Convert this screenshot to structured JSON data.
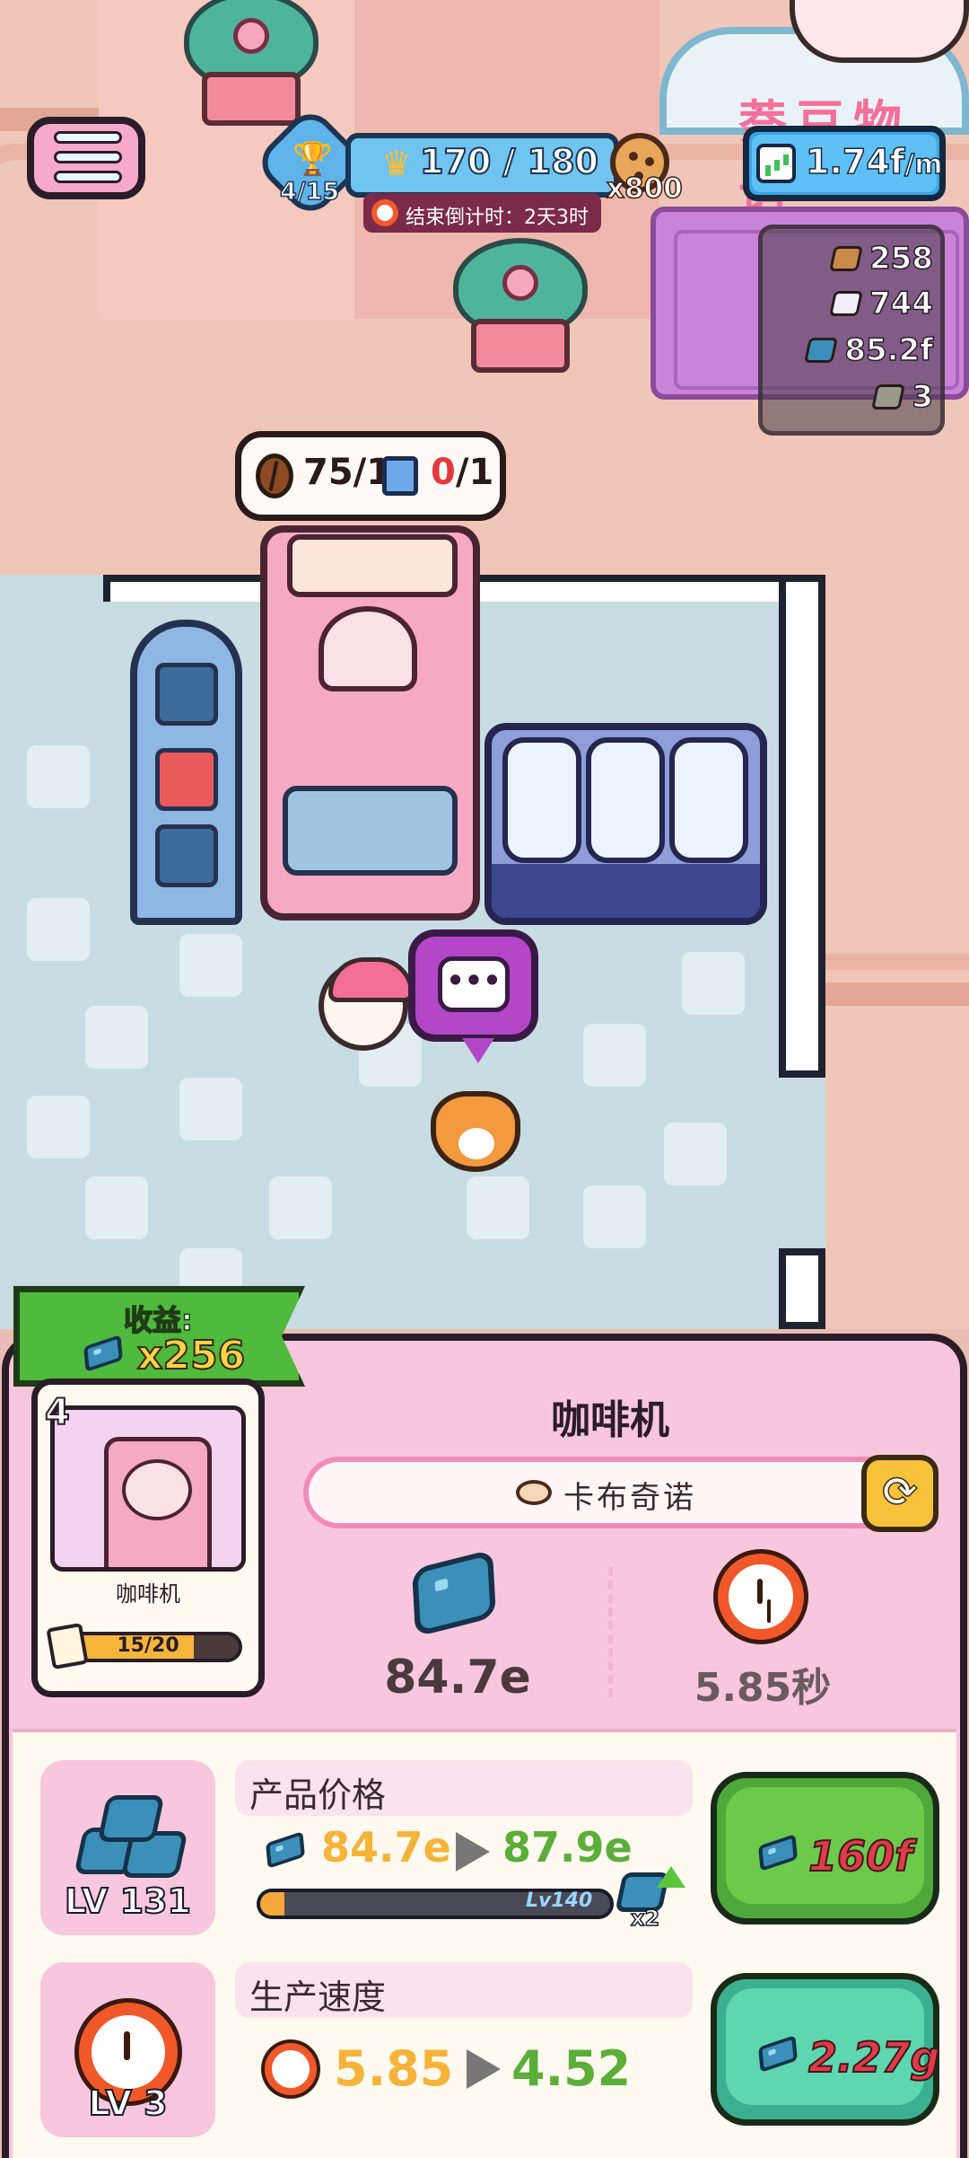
{
  "hud": {
    "trophy_progress": "4/15",
    "crown_progress": "170 / 180",
    "countdown": "结束倒计时：2天3时",
    "cookie_multiplier": "x800",
    "earn_rate": "1.74f",
    "earn_rate_unit": "/m"
  },
  "world": {
    "shop_sign_text": "萘豆物语",
    "speech_bubble": "•••"
  },
  "resources": [
    {
      "icon": "bread-icon",
      "value": "258",
      "color": "#c98a4a"
    },
    {
      "icon": "sugar-icon",
      "value": "744",
      "color": "#f2eef8"
    },
    {
      "icon": "gem-icon",
      "value": "85.2f",
      "color": "#3b8fb8"
    },
    {
      "icon": "stone-icon",
      "value": "3",
      "color": "#9a9a8a"
    }
  ],
  "ingredients": {
    "beans": "75/1",
    "milk_have": "0",
    "milk_need": "/1"
  },
  "income": {
    "label": "收益:",
    "value": "x256"
  },
  "card": {
    "level": "4",
    "name": "咖啡机",
    "progress_text": "15/20",
    "progress_fraction": 0.75
  },
  "machine": {
    "title": "咖啡机",
    "recipe": "卡布奇诺",
    "swap_symbol": "⟳",
    "price": "84.7e",
    "time": "5.85秒"
  },
  "upgrades": {
    "price": {
      "title": "产品价格",
      "level": "LV 131",
      "old_value": "84.7e",
      "new_value": "87.9e",
      "milestone": "Lv140",
      "milestone_fraction": 0.07,
      "bonus": "x2",
      "cost": "160f",
      "button_color": "#6cc94a",
      "button_color_dark": "#4fa83a"
    },
    "speed": {
      "title": "生产速度",
      "level": "LV 3",
      "old_value": "5.85",
      "new_value": "4.52",
      "cost": "2.27g",
      "button_color": "#5ed6b0",
      "button_color_dark": "#3ab08e"
    }
  }
}
